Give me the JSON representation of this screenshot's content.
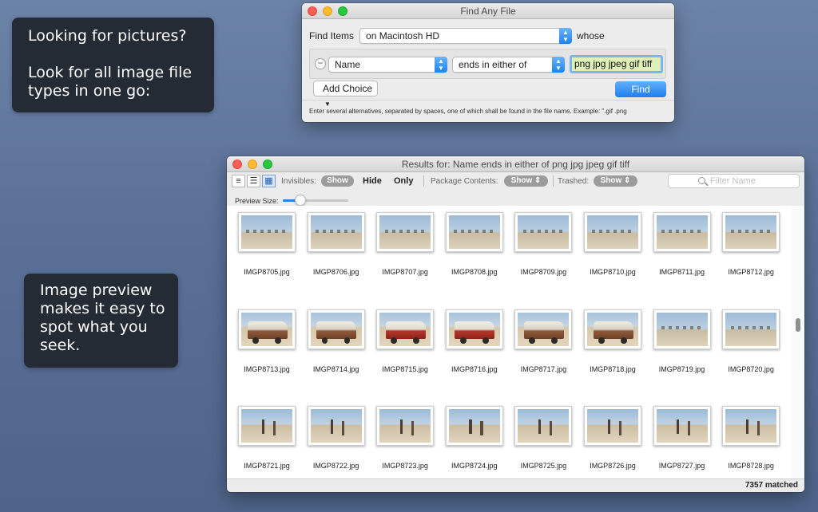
{
  "callouts": {
    "top": "Looking for pictures?\n\nLook for all image file types in one go:",
    "bottom": "Image preview makes it easy to spot what you seek."
  },
  "find_window": {
    "title": "Find Any File",
    "find_items_label": "Find Items",
    "location_value": "on Macintosh HD",
    "whose_label": "whose",
    "criteria": {
      "remove_glyph": "−",
      "attribute": "Name",
      "operator": "ends in either of",
      "value": "png jpg jpeg gif tiff"
    },
    "add_choice_label": "Add Choice",
    "find_button_label": "Find",
    "hint": "Enter several alternatives, separated by spaces, one of which shall be found in the file name. Example: \".gif .png"
  },
  "results_window": {
    "title": "Results for: Name ends in either of png jpg jpeg gif tiff",
    "toolbar": {
      "invisibles_label": "Invisibles:",
      "show_label": "Show",
      "hide_label": "Hide",
      "only_label": "Only",
      "package_contents_label": "Package Contents:",
      "package_value": "Show",
      "trashed_label": "Trashed:",
      "trashed_value": "Show",
      "filter_placeholder": "Filter Name"
    },
    "preview_size_label": "Preview Size:",
    "preview_size_level": 0.27,
    "status": "7357 matched",
    "files": [
      {
        "name": "IMGP8705.jpg",
        "kind": "desert"
      },
      {
        "name": "IMGP8706.jpg",
        "kind": "desert"
      },
      {
        "name": "IMGP8707.jpg",
        "kind": "desert"
      },
      {
        "name": "IMGP8708.jpg",
        "kind": "desert"
      },
      {
        "name": "IMGP8709.jpg",
        "kind": "desert"
      },
      {
        "name": "IMGP8710.jpg",
        "kind": "desert"
      },
      {
        "name": "IMGP8711.jpg",
        "kind": "desert"
      },
      {
        "name": "IMGP8712.jpg",
        "kind": "desert"
      },
      {
        "name": "IMGP8713.jpg",
        "kind": "truck"
      },
      {
        "name": "IMGP8714.jpg",
        "kind": "truck"
      },
      {
        "name": "IMGP8715.jpg",
        "kind": "truck red"
      },
      {
        "name": "IMGP8716.jpg",
        "kind": "truck red"
      },
      {
        "name": "IMGP8717.jpg",
        "kind": "truck"
      },
      {
        "name": "IMGP8718.jpg",
        "kind": "truck"
      },
      {
        "name": "IMGP8719.jpg",
        "kind": "desert"
      },
      {
        "name": "IMGP8720.jpg",
        "kind": "desert"
      },
      {
        "name": "IMGP8721.jpg",
        "kind": "people"
      },
      {
        "name": "IMGP8722.jpg",
        "kind": "people"
      },
      {
        "name": "IMGP8723.jpg",
        "kind": "people"
      },
      {
        "name": "IMGP8724.jpg",
        "kind": "people"
      },
      {
        "name": "IMGP8725.jpg",
        "kind": "people"
      },
      {
        "name": "IMGP8726.jpg",
        "kind": "people"
      },
      {
        "name": "IMGP8727.jpg",
        "kind": "people"
      },
      {
        "name": "IMGP8728.jpg",
        "kind": "people"
      }
    ]
  }
}
